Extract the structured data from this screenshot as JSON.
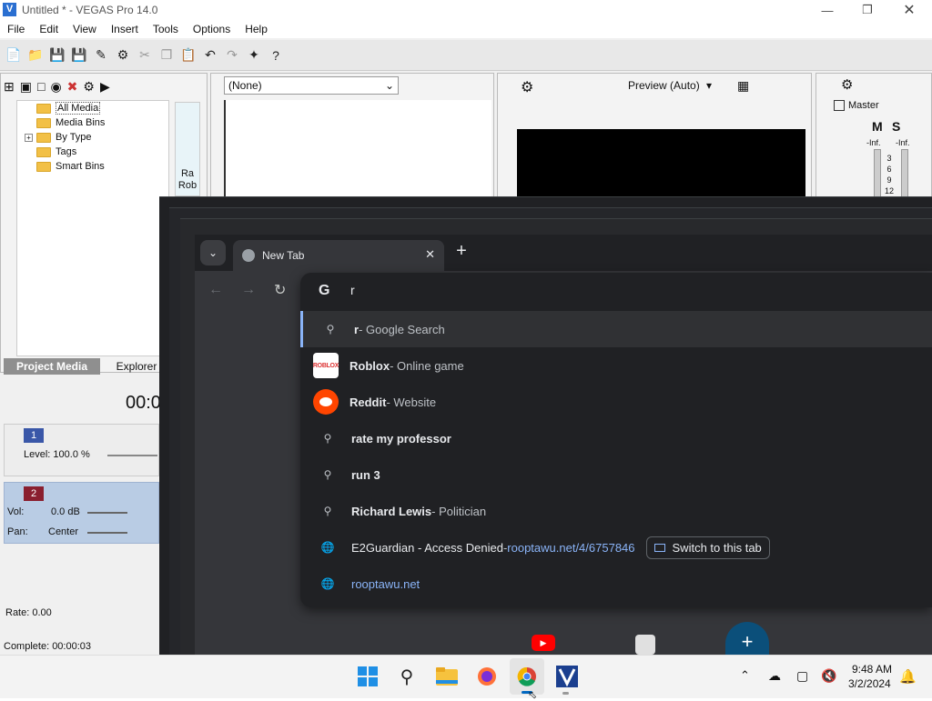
{
  "vegas": {
    "title": "Untitled * - VEGAS Pro 14.0",
    "menu": [
      "File",
      "Edit",
      "View",
      "Insert",
      "Tools",
      "Options",
      "Help"
    ],
    "preview_dropdown": "(None)",
    "preview_quality": "Preview (Auto)",
    "master_label": "Master",
    "mute": "M",
    "solo": "S",
    "inf_left": "-Inf.",
    "inf_right": "-Inf.",
    "meter_ticks": [
      "3",
      "6",
      "9",
      "12"
    ],
    "tree": [
      "All Media",
      "Media Bins",
      "By Type",
      "Tags",
      "Smart Bins"
    ],
    "tabs": [
      "Project Media",
      "Explorer"
    ],
    "timecode": "00:0",
    "track1": {
      "number": "1",
      "level": "Level: 100.0 %"
    },
    "track2": {
      "number": "2",
      "vol_label": "Vol:",
      "vol_value": "0.0 dB",
      "pan_label": "Pan:",
      "pan_value": "Center"
    },
    "rate": "Rate: 0.00",
    "complete": "Complete: 00:00:03",
    "thumb_text_1": "Ra",
    "thumb_text_2": "Rob"
  },
  "chrome": {
    "tab_title": "New Tab",
    "omnibox_text": "r",
    "suggestions": [
      {
        "icon": "search-icon",
        "bold": "r",
        "rest": " - Google Search",
        "type": "search"
      },
      {
        "icon": "roblox-favicon",
        "bold": "Roblox",
        "rest": " - Online game",
        "type": "site"
      },
      {
        "icon": "reddit-favicon",
        "bold": "Reddit",
        "rest": " - Website",
        "type": "site"
      },
      {
        "icon": "search-icon",
        "bold": "rate my professor",
        "rest": "",
        "type": "search"
      },
      {
        "icon": "search-icon",
        "bold": "run 3",
        "rest": "",
        "type": "search"
      },
      {
        "icon": "search-icon",
        "bold": "Richard Lewis",
        "rest": " - Politician",
        "type": "search"
      },
      {
        "icon": "globe-icon",
        "bold": "E2Guardian - Access Denied",
        "rest": " - ",
        "url": "rooptawu.net/4/6757846",
        "type": "history"
      },
      {
        "icon": "globe-icon",
        "bold": "",
        "rest": "",
        "url": "rooptawu.net",
        "type": "url"
      }
    ],
    "switch_tab_label": "Switch to this tab",
    "roblox_favicon_text": "ROBLOX"
  },
  "taskbar": {
    "time": "9:48 AM",
    "date": "3/2/2024"
  }
}
